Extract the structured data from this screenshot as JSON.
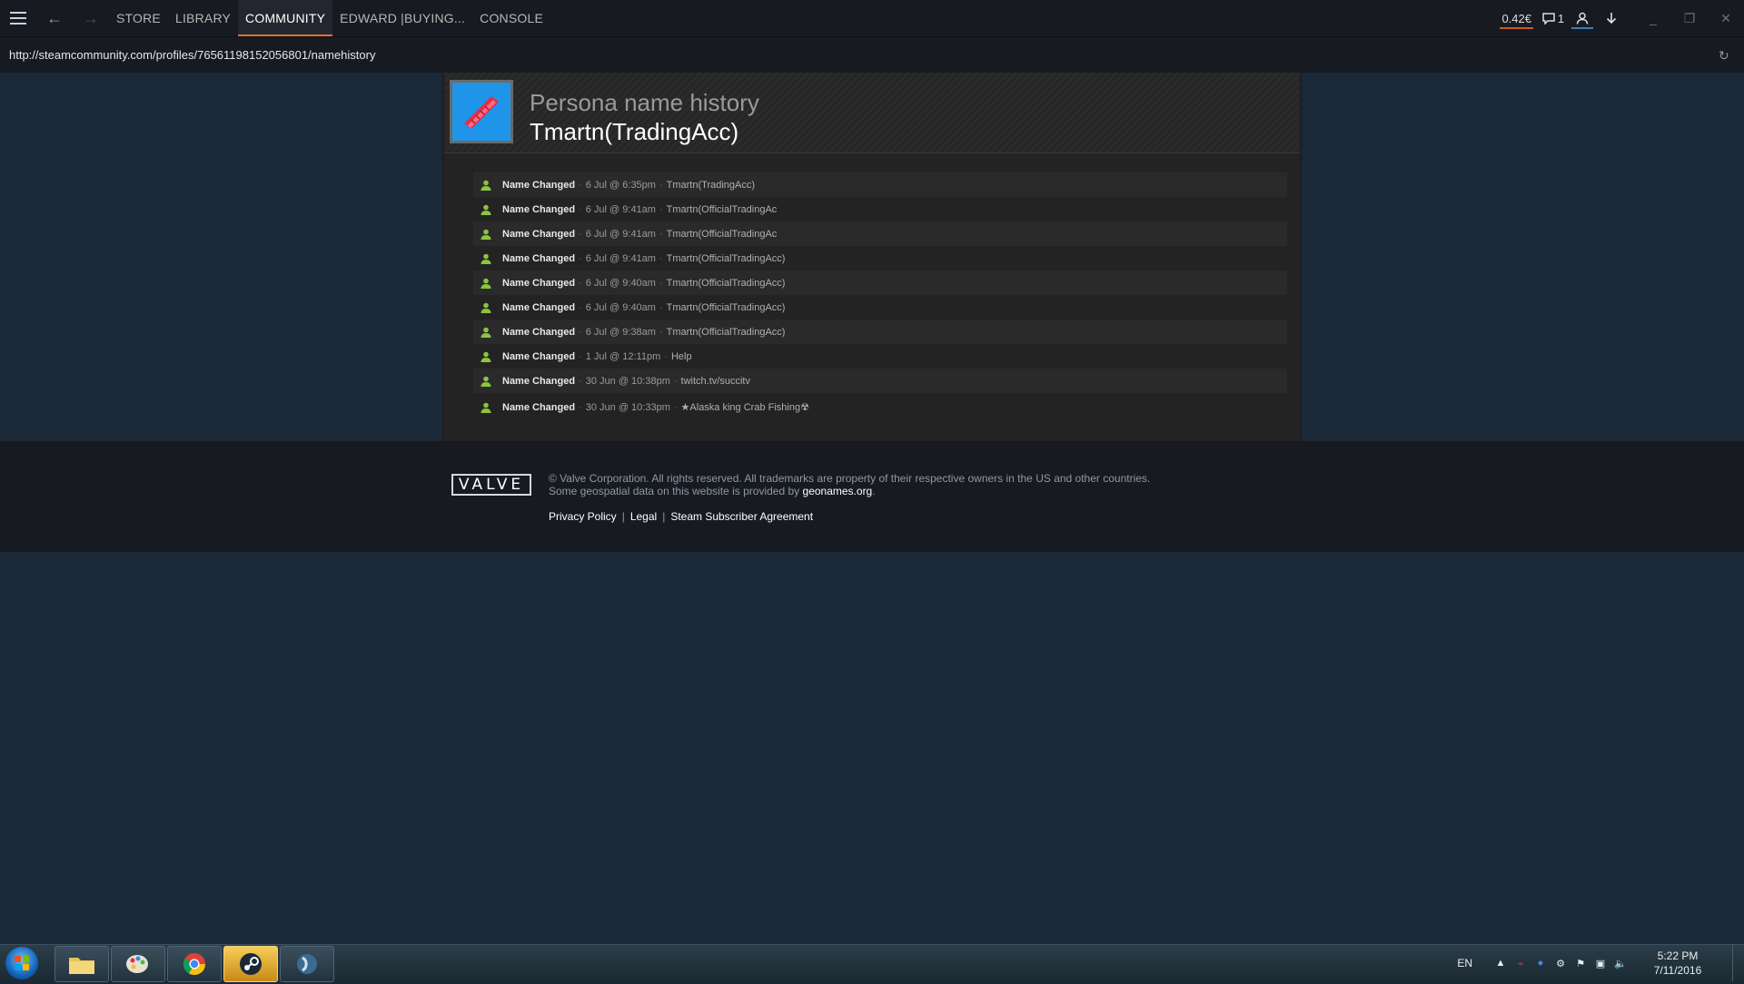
{
  "nav": {
    "tabs": [
      "STORE",
      "LIBRARY",
      "COMMUNITY",
      "EDWARD |BUYING...",
      "CONSOLE"
    ],
    "active_tab": "COMMUNITY",
    "wallet": "0.42€",
    "notifications": "1"
  },
  "urlbar": {
    "url": "http://steamcommunity.com/profiles/76561198152056801/namehistory"
  },
  "profile": {
    "heading": "Persona name history",
    "name": "Tmartn(TradingAcc)"
  },
  "history": [
    {
      "label": "Name Changed",
      "time": "6 Jul @ 6:35pm",
      "name": "Tmartn(TradingAcc)"
    },
    {
      "label": "Name Changed",
      "time": "6 Jul @ 9:41am",
      "name": "Tmartn(OfficialTradingAc"
    },
    {
      "label": "Name Changed",
      "time": "6 Jul @ 9:41am",
      "name": "Tmartn(OfficialTradingAc"
    },
    {
      "label": "Name Changed",
      "time": "6 Jul @ 9:41am",
      "name": "Tmartn(OfficialTradingAcc)"
    },
    {
      "label": "Name Changed",
      "time": "6 Jul @ 9:40am",
      "name": "Tmartn(OfficialTradingAcc)"
    },
    {
      "label": "Name Changed",
      "time": "6 Jul @ 9:40am",
      "name": "Tmartn(OfficialTradingAcc)"
    },
    {
      "label": "Name Changed",
      "time": "6 Jul @ 9:38am",
      "name": "Tmartn(OfficialTradingAcc)"
    },
    {
      "label": "Name Changed",
      "time": "1 Jul @ 12:11pm",
      "name": "Help"
    },
    {
      "label": "Name Changed",
      "time": "30 Jun @ 10:38pm",
      "name": "twitch.tv/succitv"
    },
    {
      "label": "Name Changed",
      "time": "30 Jun @ 10:33pm",
      "name": "★Alaska king Crab Fishing☢"
    }
  ],
  "footer": {
    "logo": "VALVE",
    "copyright": "© Valve Corporation. All rights reserved. All trademarks are property of their respective owners in the US and other countries.",
    "geo_text": "Some geospatial data on this website is provided by",
    "geo_link": "geonames.org",
    "geo_end": ".",
    "links": [
      "Privacy Policy",
      "Legal",
      "Steam Subscriber Agreement"
    ]
  },
  "taskbar": {
    "lang": "EN",
    "time": "5:22 PM",
    "date": "7/11/2016"
  },
  "colors": {
    "accent_orange": "#e0703a",
    "avatar_blue": "#1e95e9",
    "status_green": "#8bc53f",
    "page_bg": "#1b2838"
  }
}
